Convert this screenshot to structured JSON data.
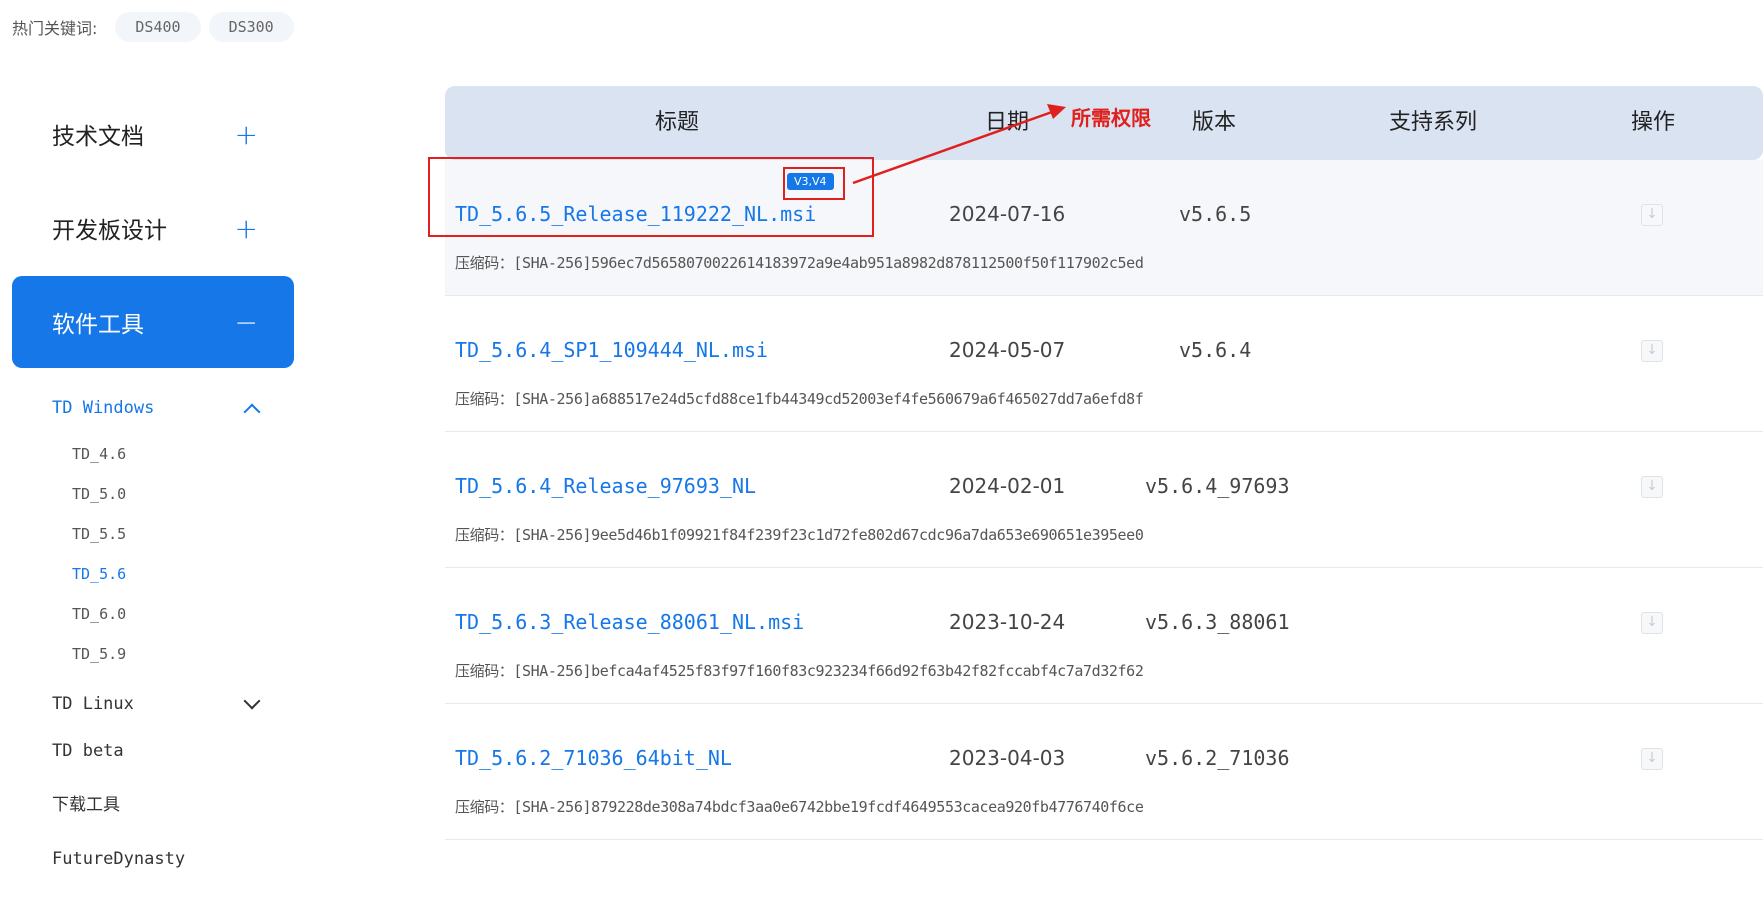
{
  "hot": {
    "label": "热门关键词:",
    "tags": [
      "DS400",
      "DS300"
    ]
  },
  "sidebar": {
    "categories": [
      {
        "label": "技术文档",
        "toggle": "+"
      },
      {
        "label": "开发板设计",
        "toggle": "+"
      },
      {
        "label": "软件工具",
        "toggle": "−"
      }
    ],
    "windows": {
      "label": "TD Windows",
      "versions": [
        "TD_4.6",
        "TD_5.0",
        "TD_5.5",
        "TD_5.6",
        "TD_6.0",
        "TD_5.9"
      ],
      "active_version": "TD_5.6"
    },
    "linux": {
      "label": "TD Linux"
    },
    "others": [
      "TD beta",
      "下载工具",
      "FutureDynasty"
    ]
  },
  "table": {
    "headers": {
      "title": "标题",
      "date": "日期",
      "version": "版本",
      "series": "支持系列",
      "action": "操作"
    },
    "hash_prefix": "压缩码：[SHA-256]",
    "rows": [
      {
        "title": "TD_5.6.5_Release_119222_NL.msi",
        "date": "2024-07-16",
        "version": "v5.6.5",
        "hash": "596ec7d5658070022614183972a9e4ab951a8982d878112500f50f117902c5ed",
        "badge": "V3,V4"
      },
      {
        "title": "TD_5.6.4_SP1_109444_NL.msi",
        "date": "2024-05-07",
        "version": "v5.6.4",
        "hash": "a688517e24d5cfd88ce1fb44349cd52003ef4fe560679a6f465027dd7a6efd8f"
      },
      {
        "title": "TD_5.6.4_Release_97693_NL",
        "date": "2024-02-01",
        "version": "v5.6.4_97693",
        "hash": "9ee5d46b1f09921f84f239f23c1d72fe802d67cdc96a7da653e690651e395ee0"
      },
      {
        "title": "TD_5.6.3_Release_88061_NL.msi",
        "date": "2023-10-24",
        "version": "v5.6.3_88061",
        "hash": "befca4af4525f83f97f160f83c923234f66d92f63b42f82fccabf4c7a7d32f62"
      },
      {
        "title": "TD_5.6.2_71036_64bit_NL",
        "date": "2023-04-03",
        "version": "v5.6.2_71036",
        "hash": "879228de308a74bdcf3aa0e6742bbe19fcdf4649553cacea920fb4776740f6ce"
      }
    ]
  },
  "annotation": {
    "label": "所需权限",
    "color": "#e0201c"
  },
  "colors": {
    "accent": "#1677e8",
    "header_bg": "#d9e3f2",
    "annotation": "#e0201c"
  }
}
